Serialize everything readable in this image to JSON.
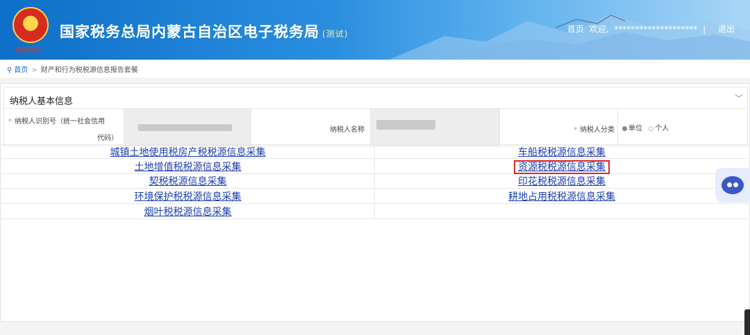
{
  "header": {
    "site_title": "国家税务总局内蒙古自治区电子税务局",
    "site_sub": "(测试)",
    "emblem_caption": "中国税务",
    "home_link": "首页",
    "welcome": "欢迎,",
    "user_masked": "********************",
    "divider": "|",
    "logout": "退出"
  },
  "breadcrumb": {
    "home": "首页",
    "separator": ">",
    "current": "财产和行为税税源信息报告套餐"
  },
  "panel": {
    "title": "纳税人基本信息",
    "taxpayer_id_label_line1": "纳税人识别号（统一社会信用",
    "taxpayer_id_label_line2": "代码）",
    "taxpayer_name_label": "纳税人名称",
    "taxpayer_type_label": "纳税人分类",
    "type_options": [
      "单位",
      "个人"
    ],
    "type_selected": "单位"
  },
  "links": {
    "left": [
      "城镇土地使用税房产税税源信息采集",
      "土地增值税税源信息采集",
      "契税税源信息采集",
      "环境保护税税源信息采集",
      "烟叶税税源信息采集"
    ],
    "right": [
      "车船税税源信息采集",
      "资源税税源信息采集",
      "印花税税源信息采集",
      "耕地占用税税源信息采集"
    ]
  },
  "colors": {
    "link": "#1c3fb0",
    "highlight_border": "#e02424",
    "required_mark": "#f08a1c",
    "header_blue": "#0d6fc7"
  }
}
